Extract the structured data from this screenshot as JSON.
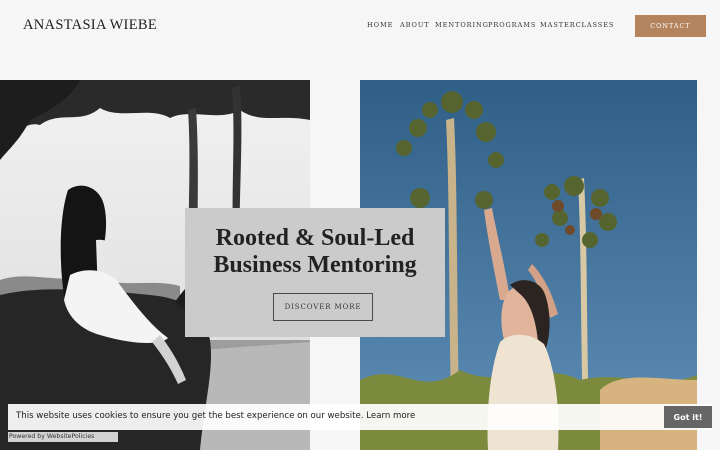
{
  "header": {
    "brand": "ANASTASIA WIEBE",
    "nav": [
      "HOME",
      "ABOUT",
      "MENTORING",
      "PROGRAMS",
      "MASTERCLASSES"
    ],
    "contact_label": "CONTACT"
  },
  "hero": {
    "title_line1": "Rooted & Soul-Led",
    "title_line2": "Business Mentoring",
    "cta_label": "DISCOVER MORE"
  },
  "cookie_banner": {
    "message": "This website uses cookies to ensure you get the best experience on our website.",
    "learn_more": "Learn more",
    "button_label": "Got it!",
    "powered_by": "Powered by WebsitePolicies"
  },
  "colors": {
    "accent": "#b3845e",
    "hero_box": "#cbcbcb",
    "cookie_button": "#666666"
  }
}
